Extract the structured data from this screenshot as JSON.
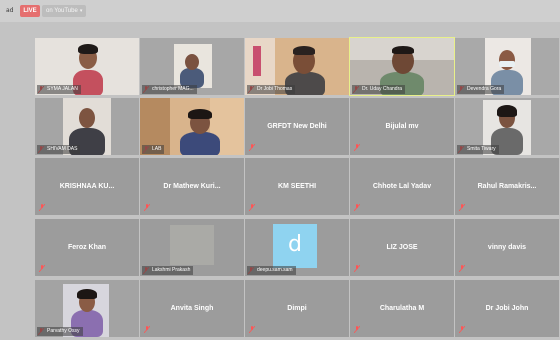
{
  "topbar": {
    "left_tag": "ad",
    "live_label": "LIVE",
    "platform_label": "on YouTube",
    "platform_chevron": "chevron-down-icon"
  },
  "colors": {
    "background": "#c3c3c3",
    "tile": "#9c9c9c",
    "live_badge": "#e56f6f",
    "active_speaker": "#e8f08a"
  },
  "participants": [
    {
      "name": "SYMA JALAN",
      "video": true
    },
    {
      "name": "christopher MAG...",
      "video": true
    },
    {
      "name": "Dr Jobi Thomas",
      "video": true
    },
    {
      "name": "Dr. Uday Chandra",
      "video": true,
      "active": true
    },
    {
      "name": "Devendra Gora",
      "video": true
    },
    {
      "name": "SHIVAM DAS",
      "video": true
    },
    {
      "name": "LAB",
      "video": true
    },
    {
      "name": "GRFDT New Delhi",
      "video": false
    },
    {
      "name": "Bijulal mv",
      "video": false
    },
    {
      "name": "Smita Tiwary",
      "video": true
    },
    {
      "name": "KRISHNAA KU...",
      "video": false
    },
    {
      "name": "Dr Mathew Kuri...",
      "video": false
    },
    {
      "name": "KM SEETHI",
      "video": false
    },
    {
      "name": "Chhote Lal Yadav",
      "video": false
    },
    {
      "name": "Rahul Ramakris...",
      "video": false
    },
    {
      "name": "Feroz Khan",
      "video": false
    },
    {
      "name": "Lakshmi Prakash",
      "video": true
    },
    {
      "name": "deepu.sam.sam",
      "video": true
    },
    {
      "name": "LIZ JOSE",
      "video": false
    },
    {
      "name": "vinny davis",
      "video": false
    },
    {
      "name": "Parvathy Ossy",
      "video": true
    },
    {
      "name": "Anvita Singh",
      "video": false
    },
    {
      "name": "Dimpi",
      "video": false
    },
    {
      "name": "Charulatha M",
      "video": false
    },
    {
      "name": "Dr Jobi John",
      "video": false
    }
  ],
  "icons": {
    "muted_mic": "microphone-muted-icon"
  }
}
